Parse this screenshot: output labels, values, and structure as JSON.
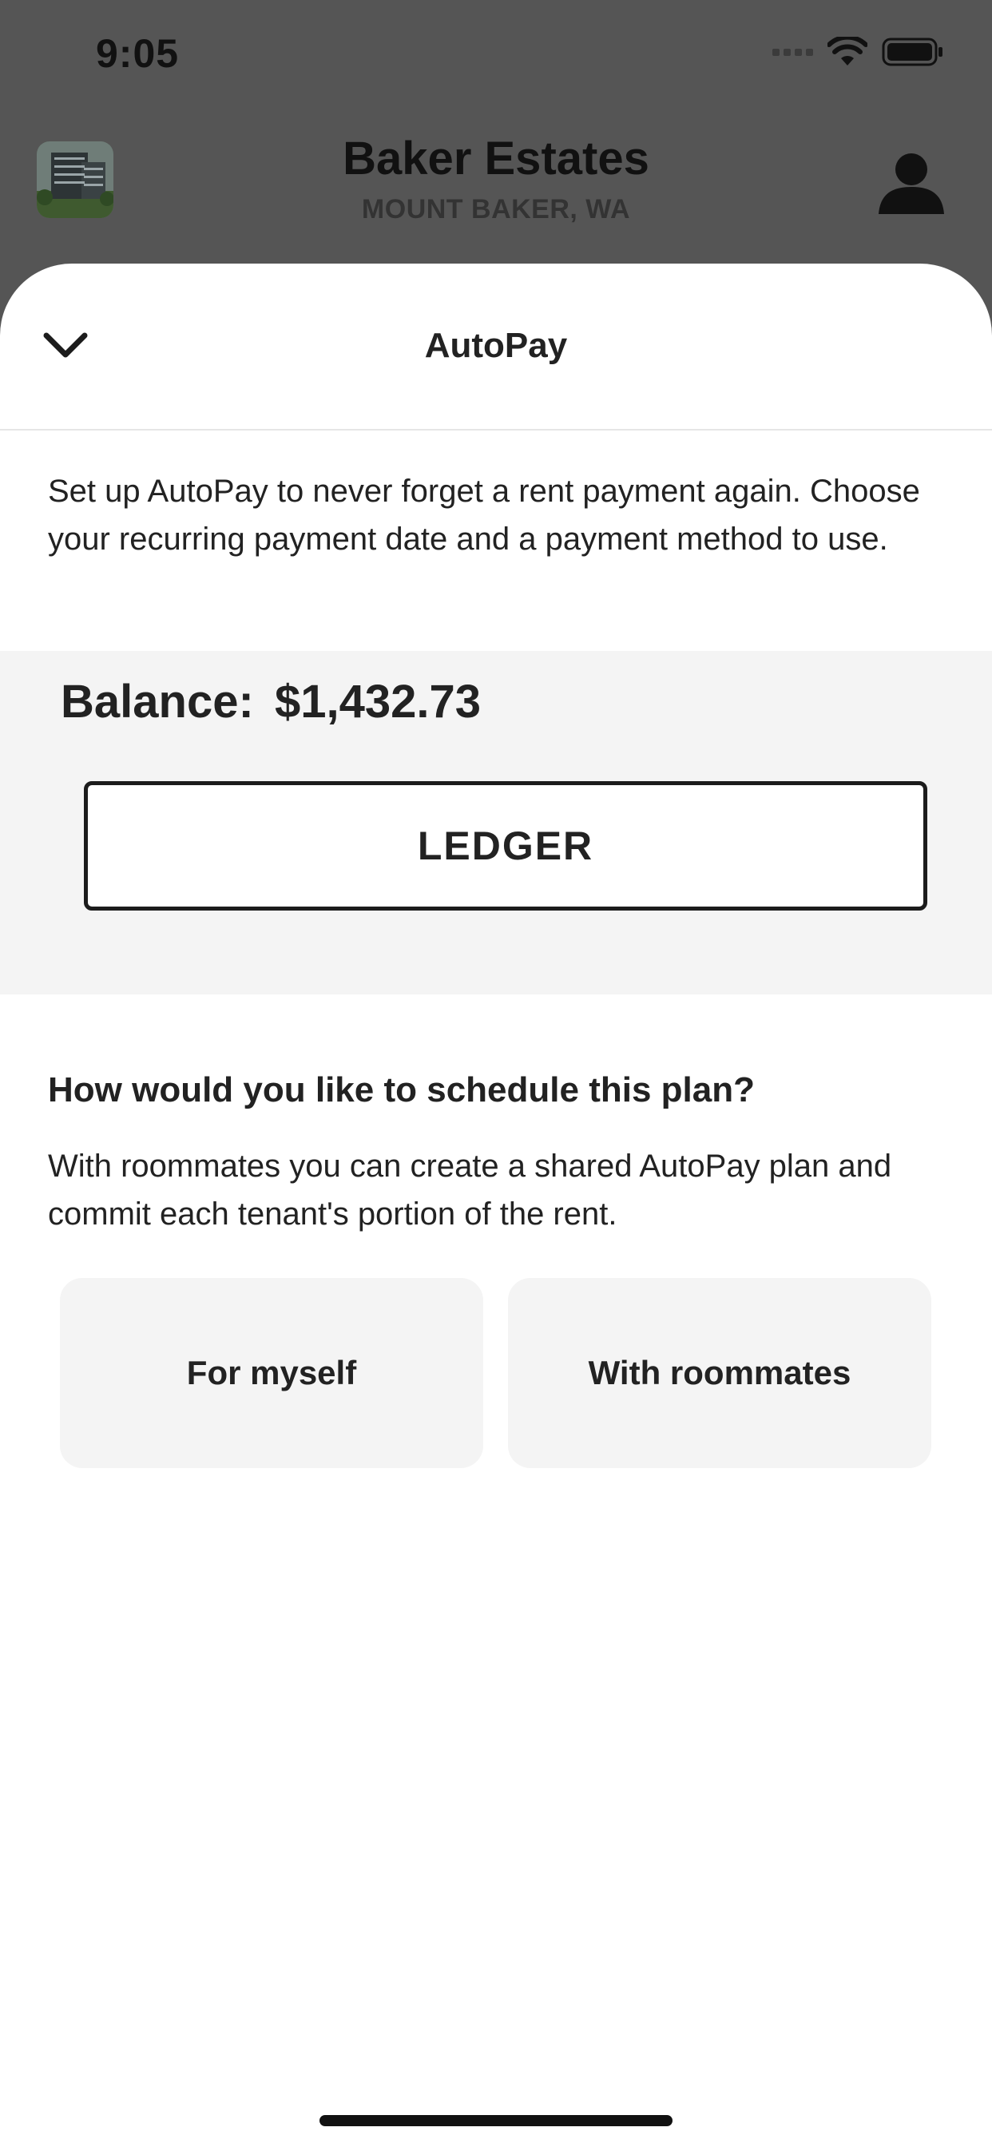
{
  "status_bar": {
    "time": "9:05"
  },
  "header": {
    "property_name": "Baker Estates",
    "location": "MOUNT BAKER, WA"
  },
  "sheet": {
    "title": "AutoPay",
    "intro": "Set up AutoPay to never forget a rent payment again. Choose your recurring payment date and a payment method to use.",
    "balance_label": "Balance:",
    "balance_value": "$1,432.73",
    "ledger_label": "LEDGER",
    "question": "How would you like to schedule this plan?",
    "question_desc": "With roommates you can create a shared AutoPay plan and commit each tenant's portion of the rent.",
    "options": [
      {
        "label": "For myself"
      },
      {
        "label": "With roommates"
      }
    ]
  },
  "colors": {
    "overlay": "#555555",
    "sheet": "#ffffff",
    "panel": "#f4f4f4",
    "text": "#222222"
  },
  "icons": [
    "cellular-signal-icon",
    "wifi-icon",
    "battery-icon",
    "profile-icon",
    "chevron-down-icon"
  ]
}
